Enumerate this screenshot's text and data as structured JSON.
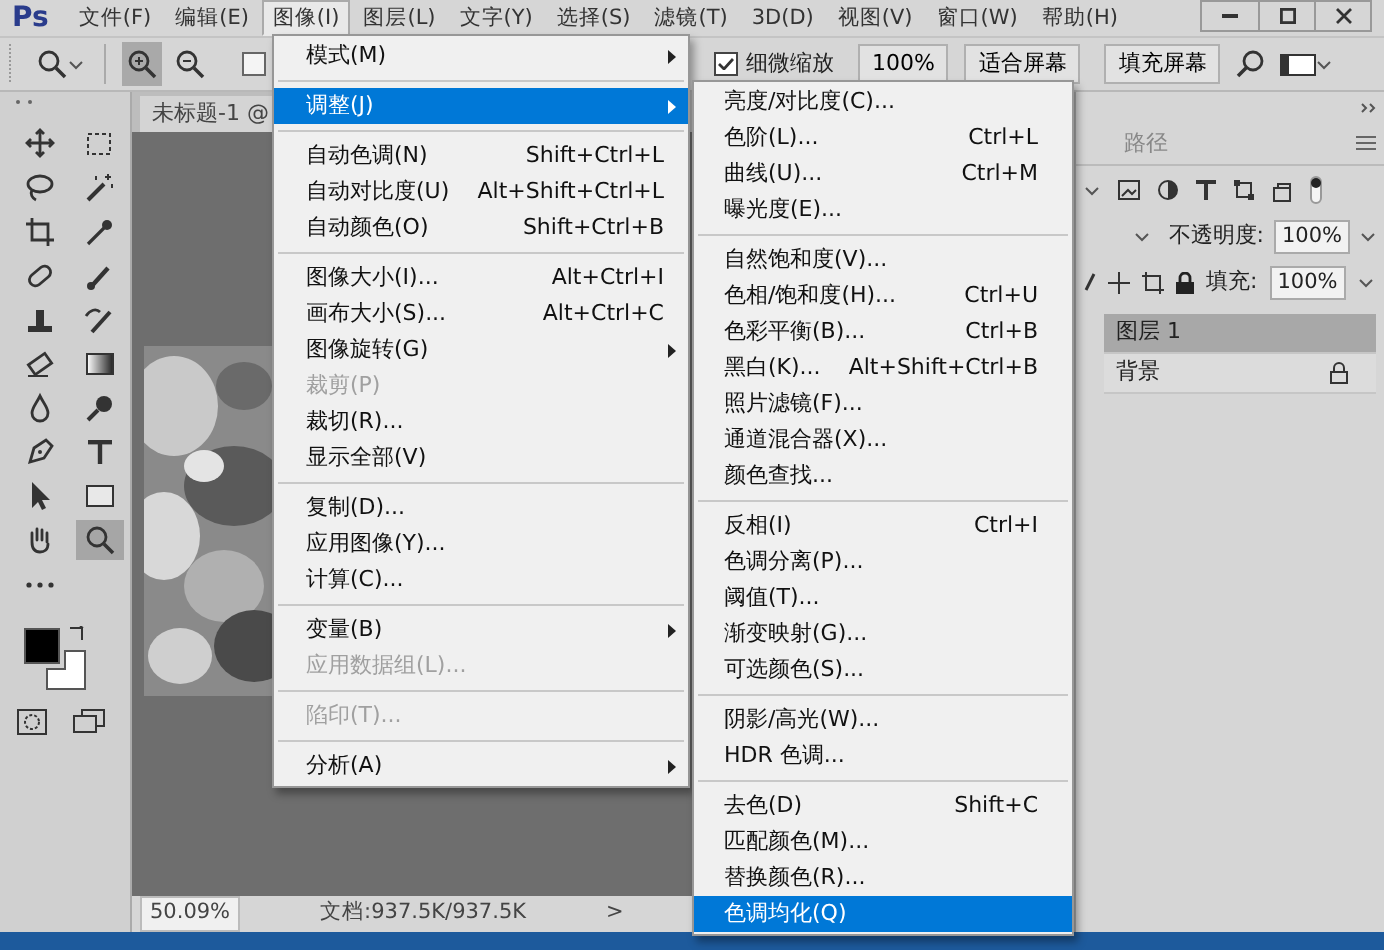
{
  "app": {
    "logo": "Ps"
  },
  "menubar": [
    {
      "label": "文件(F)",
      "selected": false
    },
    {
      "label": "编辑(E)",
      "selected": false
    },
    {
      "label": "图像(I)",
      "selected": true
    },
    {
      "label": "图层(L)",
      "selected": false
    },
    {
      "label": "文字(Y)",
      "selected": false
    },
    {
      "label": "选择(S)",
      "selected": false
    },
    {
      "label": "滤镜(T)",
      "selected": false
    },
    {
      "label": "3D(D)",
      "selected": false
    },
    {
      "label": "视图(V)",
      "selected": false
    },
    {
      "label": "窗口(W)",
      "selected": false
    },
    {
      "label": "帮助(H)",
      "selected": false
    }
  ],
  "options_bar": {
    "zoom_modes": [
      {
        "kind": "zoom-in",
        "selected": true
      },
      {
        "kind": "zoom-out",
        "selected": false
      }
    ],
    "resize_windows": {
      "checked": false
    },
    "fine_zoom": {
      "label": "细微缩放",
      "checked": true
    },
    "buttons": [
      "100%",
      "适合屏幕",
      "填充屏幕"
    ]
  },
  "tools": [
    {
      "kind": "move",
      "selected": false
    },
    {
      "kind": "marquee",
      "selected": false
    },
    {
      "kind": "lasso",
      "selected": false
    },
    {
      "kind": "wand",
      "selected": false
    },
    {
      "kind": "crop",
      "selected": false
    },
    {
      "kind": "eyedropper",
      "selected": false
    },
    {
      "kind": "healing",
      "selected": false
    },
    {
      "kind": "brush",
      "selected": false
    },
    {
      "kind": "stamp",
      "selected": false
    },
    {
      "kind": "history",
      "selected": false
    },
    {
      "kind": "eraser",
      "selected": false
    },
    {
      "kind": "gradient",
      "selected": false
    },
    {
      "kind": "blur",
      "selected": false
    },
    {
      "kind": "dodge",
      "selected": false
    },
    {
      "kind": "pen",
      "selected": false
    },
    {
      "kind": "type",
      "selected": false
    },
    {
      "kind": "path",
      "selected": false
    },
    {
      "kind": "shape",
      "selected": false
    },
    {
      "kind": "hand",
      "selected": false
    },
    {
      "kind": "zoom",
      "selected": true
    },
    {
      "kind": "more",
      "selected": false
    }
  ],
  "document": {
    "tab": "未标题-1 @",
    "zoom": "50.09%",
    "info": "文档:937.5K/937.5K",
    "nav": ">"
  },
  "panel": {
    "tabs": [
      {
        "label": "路径",
        "selected": false
      }
    ],
    "opacity_label": "不透明度:",
    "opacity": "100%",
    "fill_label": "填充:",
    "fill": "100%",
    "layers": [
      {
        "name": "图层 1",
        "selected": true,
        "locked": false
      },
      {
        "name": "背景",
        "selected": false,
        "locked": true
      }
    ]
  },
  "menu": {
    "groups": [
      [
        {
          "label": "模式(M)",
          "submenu": true,
          "disabled": false,
          "selected": false
        }
      ],
      [
        {
          "label": "调整(J)",
          "submenu": true,
          "disabled": false,
          "selected": true
        }
      ],
      [
        {
          "label": "自动色调(N)",
          "shortcut": "Shift+Ctrl+L",
          "submenu": false,
          "disabled": false,
          "selected": false
        },
        {
          "label": "自动对比度(U)",
          "shortcut": "Alt+Shift+Ctrl+L",
          "submenu": false,
          "disabled": false,
          "selected": false
        },
        {
          "label": "自动颜色(O)",
          "shortcut": "Shift+Ctrl+B",
          "submenu": false,
          "disabled": false,
          "selected": false
        }
      ],
      [
        {
          "label": "图像大小(I)...",
          "shortcut": "Alt+Ctrl+I",
          "submenu": false,
          "disabled": false,
          "selected": false
        },
        {
          "label": "画布大小(S)...",
          "shortcut": "Alt+Ctrl+C",
          "submenu": false,
          "disabled": false,
          "selected": false
        },
        {
          "label": "图像旋转(G)",
          "submenu": true,
          "disabled": false,
          "selected": false
        },
        {
          "label": "裁剪(P)",
          "submenu": false,
          "disabled": true,
          "selected": false
        },
        {
          "label": "裁切(R)...",
          "submenu": false,
          "disabled": false,
          "selected": false
        },
        {
          "label": "显示全部(V)",
          "submenu": false,
          "disabled": false,
          "selected": false
        }
      ],
      [
        {
          "label": "复制(D)...",
          "submenu": false,
          "disabled": false,
          "selected": false
        },
        {
          "label": "应用图像(Y)...",
          "submenu": false,
          "disabled": false,
          "selected": false
        },
        {
          "label": "计算(C)...",
          "submenu": false,
          "disabled": false,
          "selected": false
        }
      ],
      [
        {
          "label": "变量(B)",
          "submenu": true,
          "disabled": false,
          "selected": false
        },
        {
          "label": "应用数据组(L)...",
          "submenu": false,
          "disabled": true,
          "selected": false
        }
      ],
      [
        {
          "label": "陷印(T)...",
          "submenu": false,
          "disabled": true,
          "selected": false
        }
      ],
      [
        {
          "label": "分析(A)",
          "submenu": true,
          "disabled": false,
          "selected": false
        }
      ]
    ]
  },
  "submenu": {
    "groups": [
      [
        {
          "label": "亮度/对比度(C)...",
          "selected": false
        },
        {
          "label": "色阶(L)...",
          "shortcut": "Ctrl+L",
          "selected": false
        },
        {
          "label": "曲线(U)...",
          "shortcut": "Ctrl+M",
          "selected": false
        },
        {
          "label": "曝光度(E)...",
          "selected": false
        }
      ],
      [
        {
          "label": "自然饱和度(V)...",
          "selected": false
        },
        {
          "label": "色相/饱和度(H)...",
          "shortcut": "Ctrl+U",
          "selected": false
        },
        {
          "label": "色彩平衡(B)...",
          "shortcut": "Ctrl+B",
          "selected": false
        },
        {
          "label": "黑白(K)...",
          "shortcut": "Alt+Shift+Ctrl+B",
          "selected": false
        },
        {
          "label": "照片滤镜(F)...",
          "selected": false
        },
        {
          "label": "通道混合器(X)...",
          "selected": false
        },
        {
          "label": "颜色查找...",
          "selected": false
        }
      ],
      [
        {
          "label": "反相(I)",
          "shortcut": "Ctrl+I",
          "selected": false
        },
        {
          "label": "色调分离(P)...",
          "selected": false
        },
        {
          "label": "阈值(T)...",
          "selected": false
        },
        {
          "label": "渐变映射(G)...",
          "selected": false
        },
        {
          "label": "可选颜色(S)...",
          "selected": false
        }
      ],
      [
        {
          "label": "阴影/高光(W)...",
          "selected": false
        },
        {
          "label": "HDR 色调...",
          "selected": false
        }
      ],
      [
        {
          "label": "去色(D)",
          "shortcut": "Shift+C",
          "selected": false
        },
        {
          "label": "匹配颜色(M)...",
          "selected": false
        },
        {
          "label": "替换颜色(R)...",
          "selected": false
        },
        {
          "label": "色调均化(Q)",
          "selected": true
        }
      ]
    ]
  }
}
